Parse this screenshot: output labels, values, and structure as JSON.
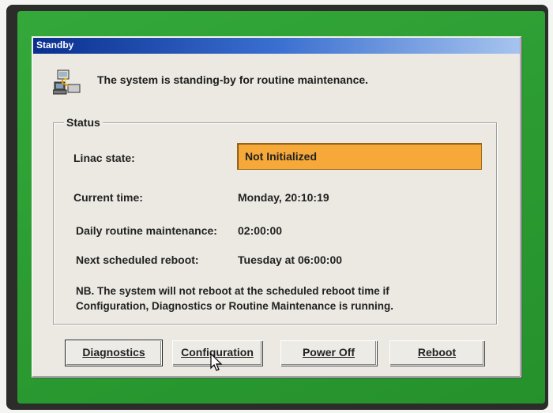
{
  "window": {
    "title": "Standby"
  },
  "message": {
    "text": "The system is standing-by for routine maintenance.",
    "icon": "computer-maintenance-icon"
  },
  "status": {
    "legend": "Status",
    "linac_state_label": "Linac state:",
    "linac_state_value": "Not Initialized",
    "linac_state_color": "#f6a838",
    "current_time_label": "Current time:",
    "current_time_value": "Monday, 20:10:19",
    "daily_maintenance_label": "Daily routine maintenance:",
    "daily_maintenance_value": "02:00:00",
    "next_reboot_label": "Next scheduled reboot:",
    "next_reboot_value": "Tuesday at 06:00:00",
    "note_line1": "NB. The system will not reboot at the scheduled reboot time if",
    "note_line2": "Configuration, Diagnostics or Routine Maintenance is running."
  },
  "buttons": {
    "diagnostics": "Diagnostics",
    "configuration": "Configuration",
    "power_off": "Power Off",
    "reboot": "Reboot"
  },
  "colors": {
    "title_bar": "#0a2f8f",
    "desktop": "#2d9e33",
    "dialog": "#ebe9e2"
  }
}
